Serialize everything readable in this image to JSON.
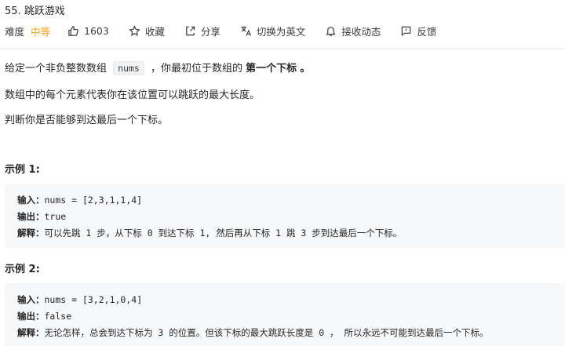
{
  "problem": {
    "title": "55. 跳跃游戏",
    "difficulty_label": "难度",
    "difficulty_value": "中等",
    "likes": "1603",
    "collect": "收藏",
    "share": "分享",
    "switch_lang": "切换为英文",
    "notify": "接收动态",
    "feedback": "反馈"
  },
  "description": {
    "p1_before": "给定一个非负整数数组",
    "p1_code": "nums",
    "p1_middle": "，你最初位于数组的",
    "p1_bold": "第一个下标",
    "p1_after": "。",
    "p2": "数组中的每个元素代表你在该位置可以跳跃的最大长度。",
    "p3": "判断你是否能够到达最后一个下标。"
  },
  "examples": [
    {
      "title": "示例 1:",
      "input_label": "输入：",
      "input": "nums = [2,3,1,1,4]",
      "output_label": "输出：",
      "output": "true",
      "explain_label": "解释：",
      "explain": "可以先跳 1 步，从下标 0 到达下标 1, 然后再从下标 1 跳 3 步到达最后一个下标。"
    },
    {
      "title": "示例 2:",
      "input_label": "输入：",
      "input": "nums = [3,2,1,0,4]",
      "output_label": "输出：",
      "output": "false",
      "explain_label": "解释：",
      "explain": "无论怎样，总会到达下标为 3 的位置。但该下标的最大跳跃长度是 0 ， 所以永远不可能到达最后一个下标。"
    }
  ],
  "colors": {
    "accent": "#ffa116",
    "code_bg": "#f7f8fa"
  }
}
